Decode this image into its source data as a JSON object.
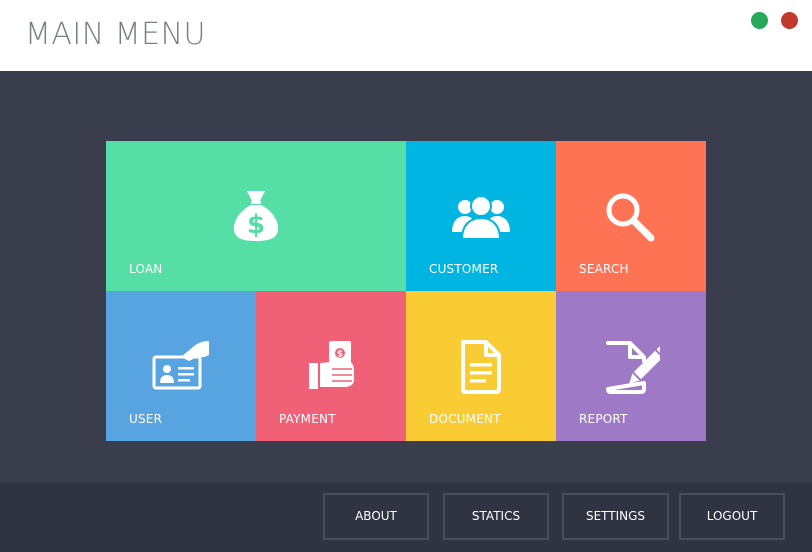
{
  "window": {
    "title": "MAIN MENU",
    "controls": {
      "minimize_color": "#28a85a",
      "close_color": "#c0392b"
    }
  },
  "tiles": [
    {
      "label": "LOAN",
      "icon": "money-bag-icon",
      "color": "#55dea5"
    },
    {
      "label": "CUSTOMER",
      "icon": "group-icon",
      "color": "#00b5e2"
    },
    {
      "label": "SEARCH",
      "icon": "search-icon",
      "color": "#ff7355"
    },
    {
      "label": "USER",
      "icon": "id-card-icon",
      "color": "#58a4e1"
    },
    {
      "label": "PAYMENT",
      "icon": "cash-in-hand-icon",
      "color": "#f06178"
    },
    {
      "label": "DOCUMENT",
      "icon": "document-icon",
      "color": "#f8cc32"
    },
    {
      "label": "REPORT",
      "icon": "edit-document-icon",
      "color": "#9e7ac6"
    }
  ],
  "footer": {
    "buttons": [
      {
        "label": "ABOUT"
      },
      {
        "label": "STATICS"
      },
      {
        "label": "SETTINGS"
      },
      {
        "label": "LOGOUT"
      }
    ]
  }
}
